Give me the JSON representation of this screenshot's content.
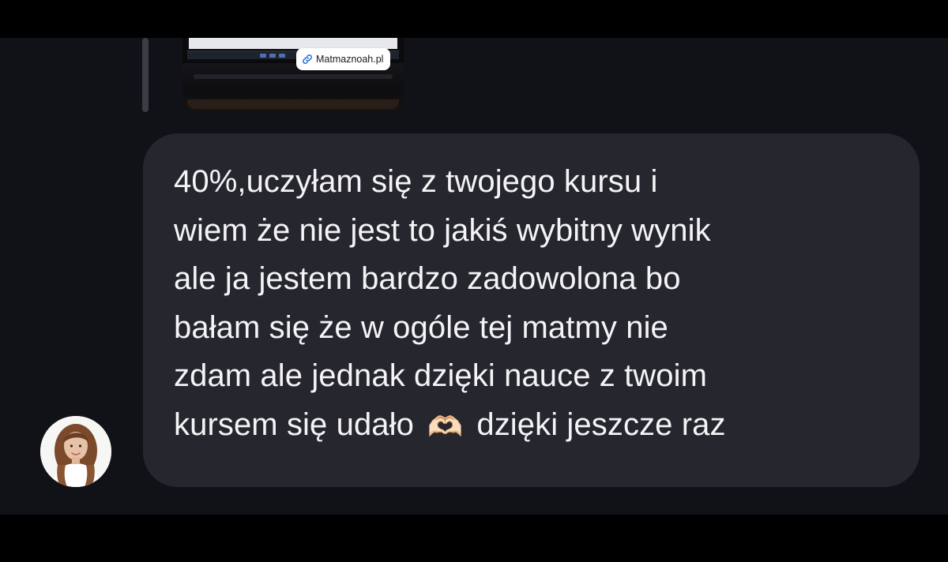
{
  "shared_post": {
    "link_icon": "link-icon",
    "link_label": "Matmaznoah.pl"
  },
  "message": {
    "lines": [
      "40%,uczyłam się z twojego kursu i",
      "wiem że nie jest to jakiś wybitny wynik",
      "ale ja jestem bardzo zadowolona bo",
      "bałam się że w ogóle tej matmy nie",
      "zdam ale jednak dzięki nauce z twoim"
    ],
    "last_line_start": "kursem się udało",
    "emoji": "🫶🏻",
    "last_line_end": "dzięki jeszcze raz"
  },
  "sender": {
    "avatar_icon": "user-avatar"
  },
  "colors": {
    "background": "#111218",
    "bubble": "#26272e",
    "text": "#f4f4f6"
  }
}
